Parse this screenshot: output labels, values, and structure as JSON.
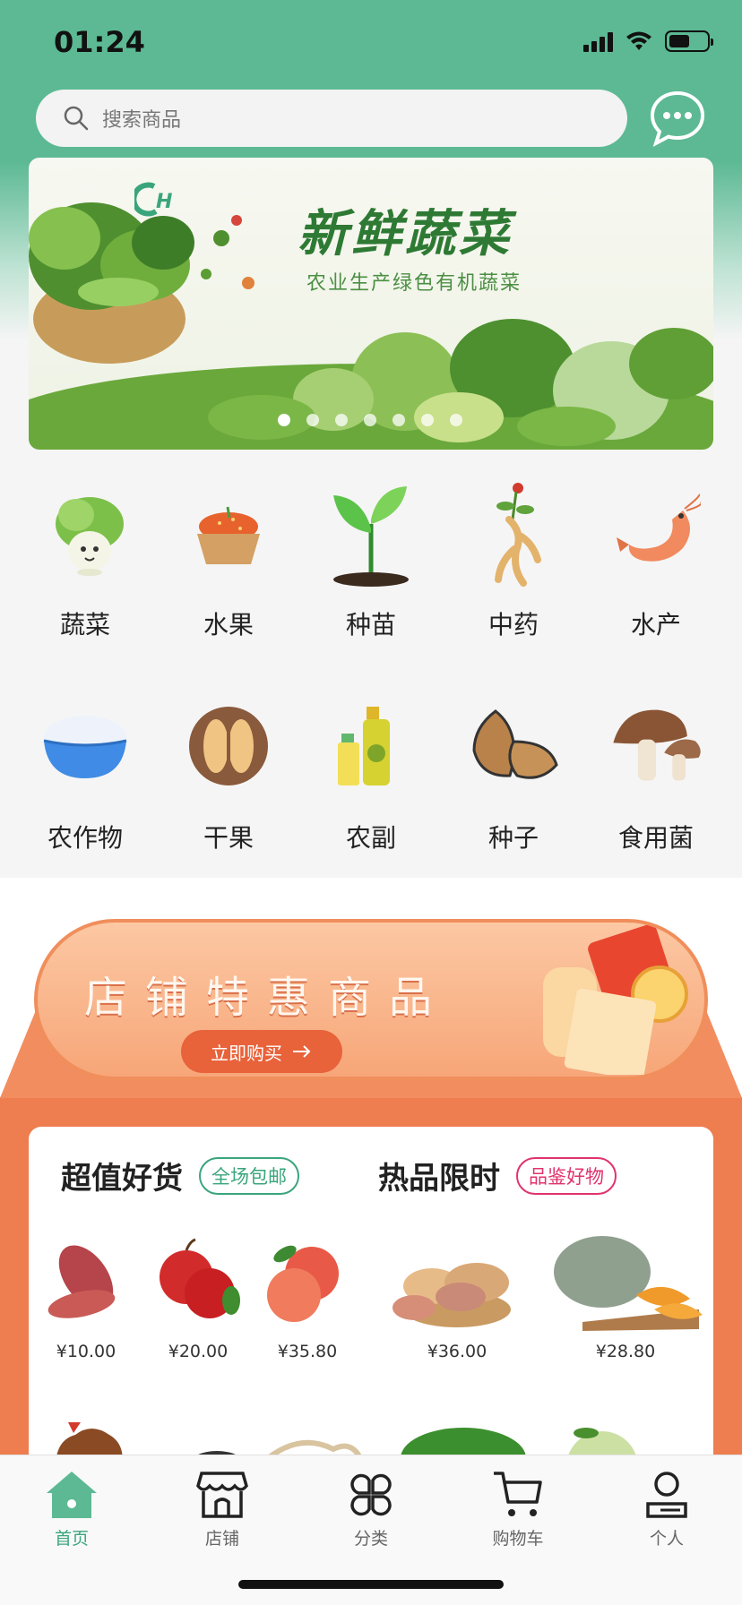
{
  "status": {
    "time": "01:24",
    "battery_level": 0.55
  },
  "search": {
    "placeholder": "搜索商品"
  },
  "banner": {
    "title": "新鲜蔬菜",
    "subtitle": "农业生产绿色有机蔬菜",
    "slide_count": 7,
    "active_slide": 0
  },
  "categories": [
    {
      "label": "蔬菜",
      "icon": "cabbage-icon"
    },
    {
      "label": "水果",
      "icon": "fruit-basket-icon"
    },
    {
      "label": "种苗",
      "icon": "seedling-icon"
    },
    {
      "label": "中药",
      "icon": "ginseng-icon"
    },
    {
      "label": "水产",
      "icon": "shrimp-icon"
    },
    {
      "label": "农作物",
      "icon": "rice-bowl-icon"
    },
    {
      "label": "干果",
      "icon": "walnut-icon"
    },
    {
      "label": "农副",
      "icon": "oil-bottle-icon"
    },
    {
      "label": "种子",
      "icon": "almond-icon"
    },
    {
      "label": "食用菌",
      "icon": "mushroom-icon"
    }
  ],
  "promo": {
    "title": "店铺特惠商品",
    "button_label": "立即购买",
    "accent": "#ee7d4f"
  },
  "goods": {
    "section_left": {
      "title": "超值好货",
      "badge": "全场包邮"
    },
    "section_right": {
      "title": "热品限时",
      "badge": "品鉴好物"
    },
    "products": [
      {
        "name": "sweet-potato",
        "price": "¥10.00"
      },
      {
        "name": "apple",
        "price": "¥20.00"
      },
      {
        "name": "peach",
        "price": "¥35.80"
      },
      {
        "name": "potato",
        "price": "¥36.00"
      },
      {
        "name": "pumpkin",
        "price": "¥28.80"
      }
    ]
  },
  "tabbar": [
    {
      "label": "首页",
      "icon": "home-icon",
      "active": true
    },
    {
      "label": "店铺",
      "icon": "store-icon",
      "active": false
    },
    {
      "label": "分类",
      "icon": "category-icon",
      "active": false
    },
    {
      "label": "购物车",
      "icon": "cart-icon",
      "active": false
    },
    {
      "label": "个人",
      "icon": "person-icon",
      "active": false
    }
  ],
  "colors": {
    "brand_green": "#5cb994",
    "active_tab": "#3aa57c",
    "promo_orange": "#ee7d4f",
    "badge_pink": "#e0336e"
  }
}
